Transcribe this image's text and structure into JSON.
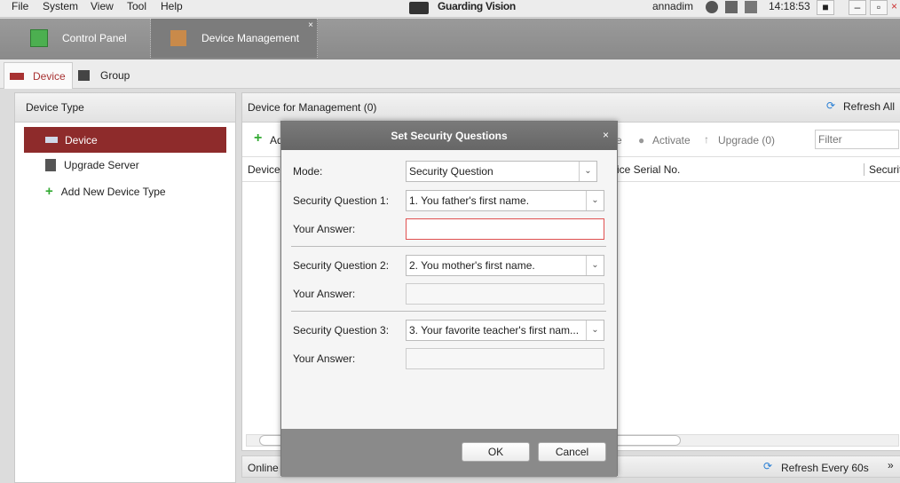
{
  "menu": [
    "File",
    "System",
    "View",
    "Tool",
    "Help"
  ],
  "app_title": "Guarding Vision",
  "user": "annadim",
  "clock": "14:18:53",
  "main_tabs": [
    {
      "label": "Control Panel"
    },
    {
      "label": "Device Management"
    }
  ],
  "sub_tabs": [
    {
      "label": "Device"
    },
    {
      "label": "Group"
    }
  ],
  "device_type": {
    "title": "Device Type",
    "items": [
      "Device",
      "Upgrade Server",
      "Add New Device Type"
    ]
  },
  "management": {
    "title": "Device for Management (0)",
    "refresh": "Refresh All",
    "toolbar": {
      "add": "Ad",
      "partial": "e",
      "activate": "Activate",
      "upgrade": "Upgrade (0)",
      "filter_placeholder": "Filter"
    },
    "columns": [
      "Device",
      "vice Serial No.",
      "Securit"
    ]
  },
  "online": {
    "title": "Online",
    "refresh": "Refresh Every 60s"
  },
  "dialog": {
    "title": "Set Security Questions",
    "mode_label": "Mode:",
    "mode_value": "Security Question",
    "questions": [
      {
        "label": "Security Question 1:",
        "value": "1. You father's first name.",
        "answer_label": "Your Answer:",
        "answer": ""
      },
      {
        "label": "Security Question 2:",
        "value": "2. You mother's first name.",
        "answer_label": "Your Answer:",
        "answer": ""
      },
      {
        "label": "Security Question 3:",
        "value": "3. Your favorite teacher's first nam...",
        "answer_label": "Your Answer:",
        "answer": ""
      }
    ],
    "ok": "OK",
    "cancel": "Cancel"
  },
  "colors": {
    "accent": "#a83232",
    "selected_item": "#8e2b2b",
    "error_border": "#e05050"
  }
}
